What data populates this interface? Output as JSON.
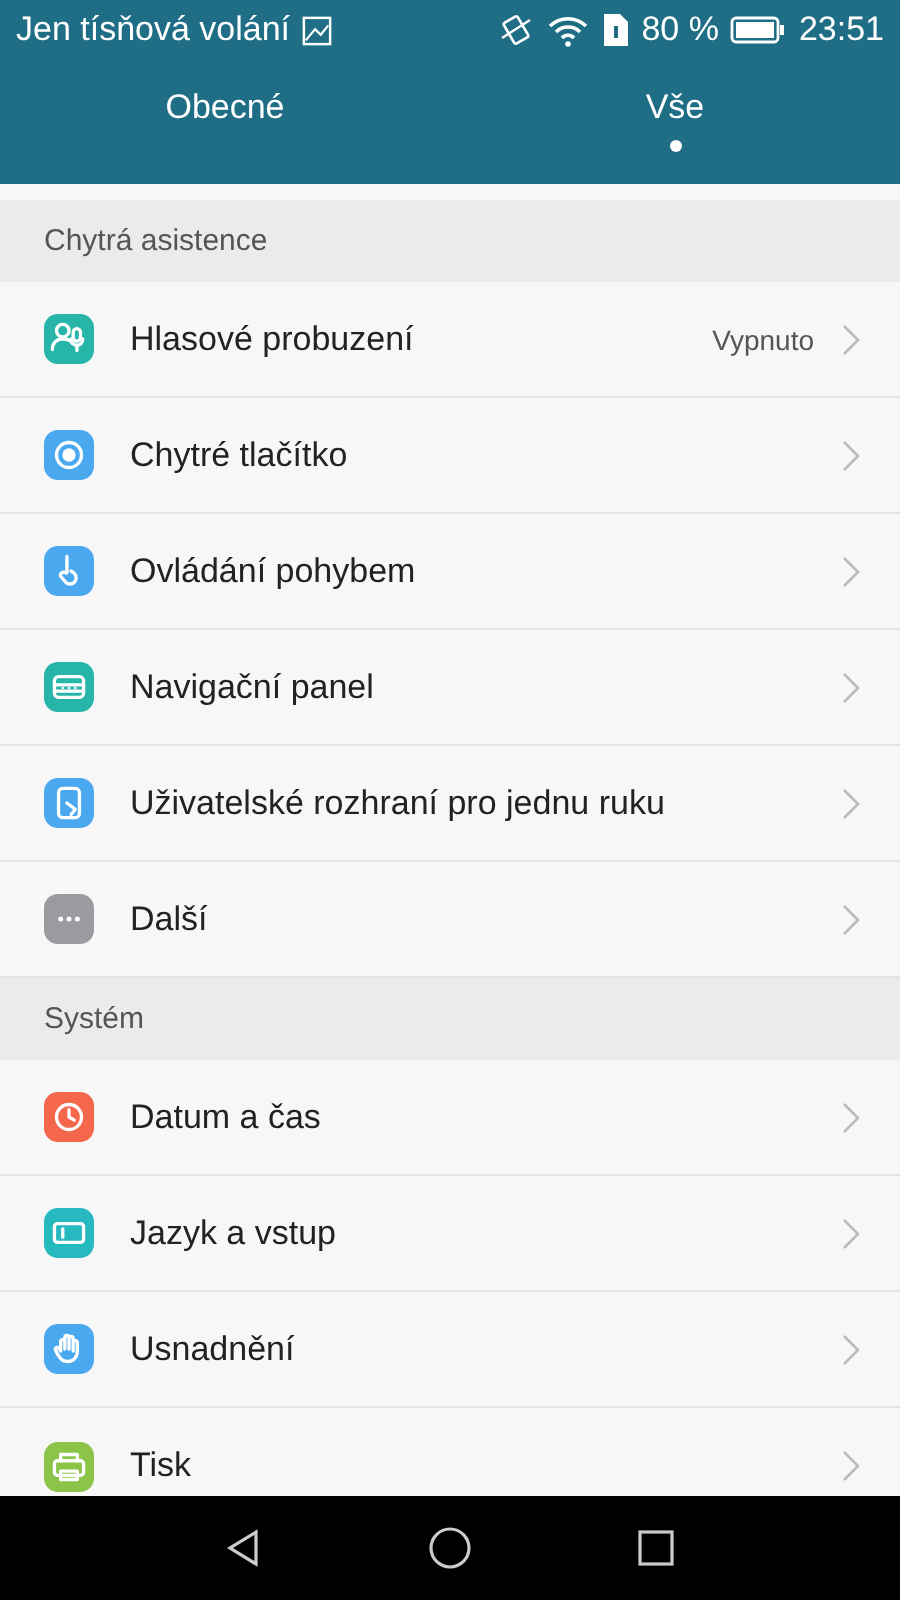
{
  "status_bar": {
    "carrier": "Jen tísňová volání",
    "battery": "80 %",
    "time": "23:51"
  },
  "tabs": [
    {
      "label": "Obecné",
      "selected": false
    },
    {
      "label": "Vše",
      "selected": true
    }
  ],
  "sections": [
    {
      "title": "Chytrá asistence",
      "items": [
        {
          "label": "Hlasové probuzení",
          "value": "Vypnuto",
          "kind": "voice",
          "color": "#26b5a8"
        },
        {
          "label": "Chytré tlačítko",
          "kind": "button",
          "color": "#4aa9ee"
        },
        {
          "label": "Ovládání pohybem",
          "kind": "gesture",
          "color": "#4aa9ee"
        },
        {
          "label": "Navigační panel",
          "kind": "navbar",
          "color": "#26b5a8"
        },
        {
          "label": "Uživatelské rozhraní pro jednu ruku",
          "kind": "onehand",
          "color": "#4aa9ee"
        },
        {
          "label": "Další",
          "kind": "more",
          "color": "#9b9b9f"
        }
      ]
    },
    {
      "title": "Systém",
      "items": [
        {
          "label": "Datum a čas",
          "kind": "clock",
          "color": "#f4674b"
        },
        {
          "label": "Jazyk a vstup",
          "kind": "keyboard",
          "color": "#26b9c0"
        },
        {
          "label": "Usnadnění",
          "kind": "hand",
          "color": "#4aa9ee"
        },
        {
          "label": "Tisk",
          "kind": "printer",
          "color": "#8cc44a"
        }
      ]
    }
  ]
}
